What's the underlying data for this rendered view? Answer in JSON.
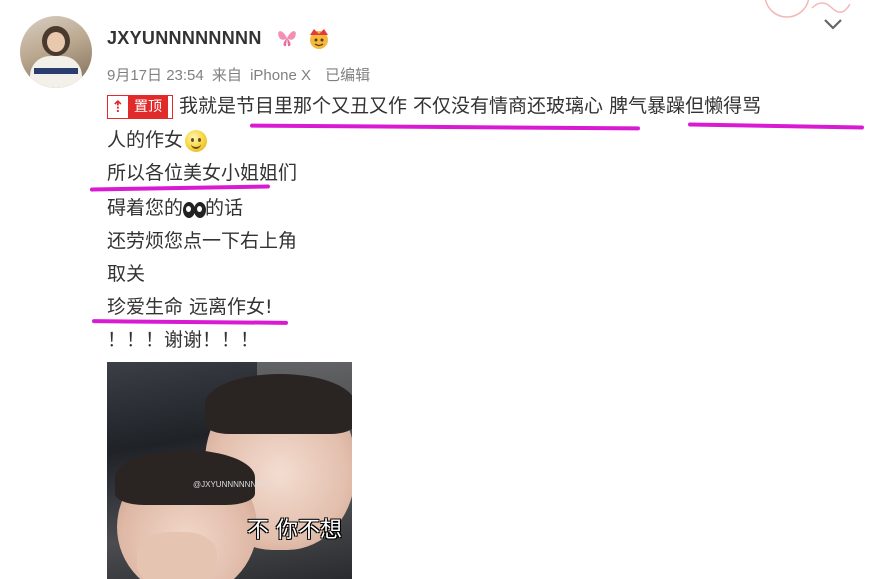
{
  "user": {
    "name": "JXYUNNNNNNNN",
    "badge1_icon": "butterfly-badge-icon",
    "badge2_icon": "crown-badge-icon"
  },
  "meta": {
    "date": "9月17日 23:54",
    "from": "来自",
    "client": "iPhone X",
    "edited": "已编辑"
  },
  "post": {
    "pin_label": "置顶",
    "pin_icon": "pin-icon",
    "line1": "我就是节目里那个又丑又作 不仅没有情商还玻璃心  脾气暴躁但懒得骂",
    "line2": "人的作女",
    "line3": "所以各位美女小姐姐们",
    "line4_a": "碍着您的",
    "line4_b": "的话",
    "line5": "还劳烦您点一下右上角",
    "line6": "取关",
    "line7": "珍爱生命 远离作女!",
    "line8": "！！！谢谢！！！"
  },
  "image": {
    "watermark": "@JXYUNNNNNNNN",
    "caption": "不 你不想"
  },
  "colors": {
    "underline": "#d81bd3",
    "pin_red": "#e12b2b",
    "meta_gray": "#808080"
  }
}
